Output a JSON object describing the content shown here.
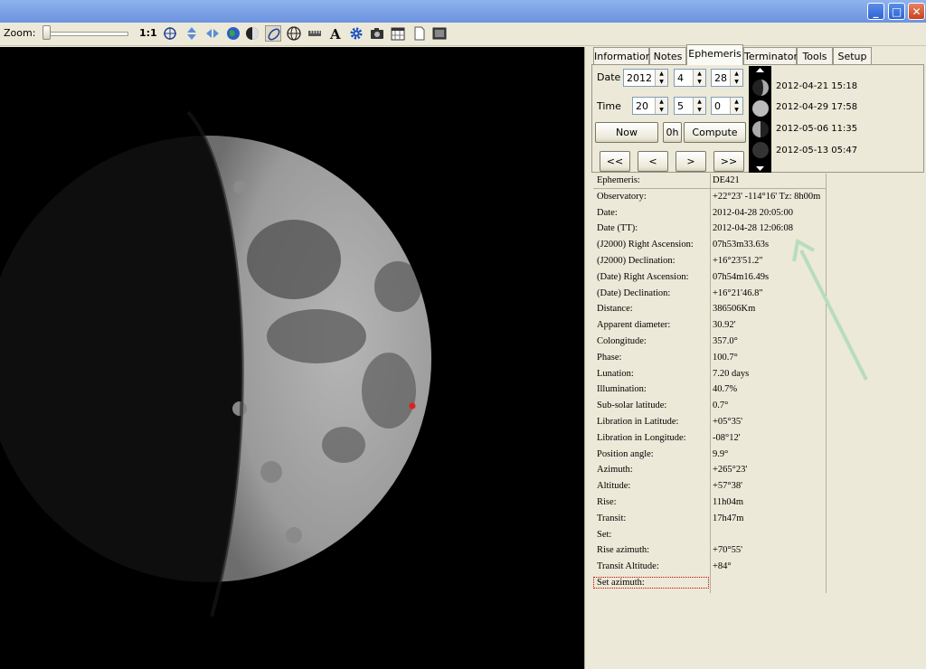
{
  "toolbar": {
    "zoom_label": "Zoom:",
    "zoom_ratio": "1:1"
  },
  "tabs": [
    "Information",
    "Notes",
    "Ephemeris",
    "Terminator",
    "Tools",
    "Setup"
  ],
  "active_tab": "Ephemeris",
  "date_form": {
    "date_label": "Date",
    "year": "2012",
    "month": "4",
    "day": "28",
    "time_label": "Time",
    "hour": "20",
    "minute": "5",
    "second": "0",
    "now_label": "Now",
    "zero_hour_label": "0h",
    "compute_label": "Compute",
    "nav": [
      "<<",
      "<",
      ">",
      ">>"
    ]
  },
  "phases": [
    "2012-04-21 15:18",
    "2012-04-29 17:58",
    "2012-05-06 11:35",
    "2012-05-13 05:47"
  ],
  "ephemeris_rows": [
    {
      "k": "Ephemeris:",
      "v": "DE421"
    },
    {
      "k": "Observatory:",
      "v": "+22°23' -114°16' Tz:  8h00m"
    },
    {
      "k": "Date:",
      "v": "2012-04-28 20:05:00"
    },
    {
      "k": "Date (TT):",
      "v": "2012-04-28 12:06:08"
    },
    {
      "k": "(J2000) Right Ascension:",
      "v": " 07h53m33.63s"
    },
    {
      "k": "(J2000) Declination:",
      "v": "+16°23'51.2\""
    },
    {
      "k": "(Date) Right Ascension:",
      "v": " 07h54m16.49s"
    },
    {
      "k": "(Date) Declination:",
      "v": "+16°21'46.8\""
    },
    {
      "k": "Distance:",
      "v": "386506Km"
    },
    {
      "k": "Apparent diameter:",
      "v": "30.92'"
    },
    {
      "k": "Colongitude:",
      "v": "357.0°"
    },
    {
      "k": "Phase:",
      "v": "100.7°"
    },
    {
      "k": "Lunation:",
      "v": "7.20 days"
    },
    {
      "k": "Illumination:",
      "v": "40.7%"
    },
    {
      "k": "Sub-solar latitude:",
      "v": "0.7°"
    },
    {
      "k": "Libration in Latitude:",
      "v": "+05°35'"
    },
    {
      "k": "Libration in Longitude:",
      "v": "-08°12'"
    },
    {
      "k": "Position angle:",
      "v": "9.9°"
    },
    {
      "k": "Azimuth:",
      "v": "+265°23'"
    },
    {
      "k": "Altitude:",
      "v": "+57°38'"
    },
    {
      "k": "Rise:",
      "v": " 11h04m"
    },
    {
      "k": "Transit:",
      "v": " 17h47m"
    },
    {
      "k": "Set:",
      "v": ""
    },
    {
      "k": "Rise azimuth:",
      "v": "+70°55'"
    },
    {
      "k": "Transit Altitude:",
      "v": "+84°"
    },
    {
      "k": "Set azimuth:",
      "v": ""
    }
  ],
  "colors": {
    "titlebar": "#7da2e6",
    "background": "#ece9d8",
    "moon_marker": "#e02020",
    "annotation_arrow": "#b7dcc0"
  }
}
